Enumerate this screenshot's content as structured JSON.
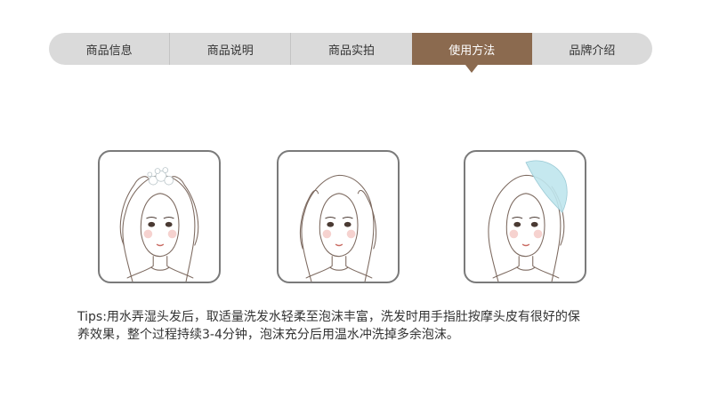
{
  "tabs": [
    {
      "label": "商品信息",
      "active": false
    },
    {
      "label": "商品说明",
      "active": false
    },
    {
      "label": "商品实拍",
      "active": false
    },
    {
      "label": "使用方法",
      "active": true
    },
    {
      "label": "品牌介绍",
      "active": false
    }
  ],
  "steps": [
    {
      "icon": "foam-lather-illustration-icon"
    },
    {
      "icon": "fingertip-massage-illustration-icon"
    },
    {
      "icon": "rinse-water-illustration-icon"
    }
  ],
  "tips": {
    "line1": "Tips:用水弄湿头发后，取适量洗发水轻柔至泡沫丰富，洗发时用手指肚按摩头皮有很好的保",
    "line2": "养效果，整个过程持续3-4分钟，泡沫充分后用温水冲洗掉多余泡沫。"
  },
  "colors": {
    "tab_bg": "#dadada",
    "tab_active": "#8b6a4f",
    "panel_border": "#7a7a7a",
    "water": "#bfe6ee"
  }
}
